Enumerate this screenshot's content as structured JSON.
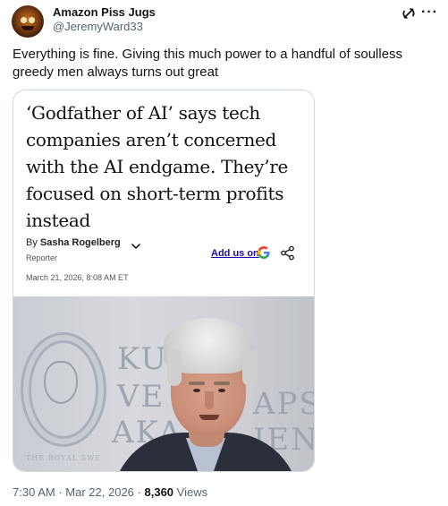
{
  "author": {
    "display_name": "Amazon Piss Jugs",
    "handle": "@JeremyWard33"
  },
  "tweet": {
    "text": "Everything is fine.  Giving this much power to a handful of soulless greedy men always turns out great"
  },
  "article": {
    "headline": "‘Godfather of AI’ says tech companies aren’t concerned with the AI endgame. They’re focused on short-term profits instead",
    "byline_prefix": "By",
    "author": "Sasha Rogelberg",
    "role": "Reporter",
    "date": "March 21, 2026, 8:08 AM ET",
    "add_us_label": "Add us on",
    "photo_wall_text": {
      "line1": "KU",
      "line2": "VE",
      "line3": "AKA",
      "right1": "APS",
      "right2": "IEN",
      "small": "THE ROYAL SWE"
    }
  },
  "meta": {
    "time": "7:30 AM",
    "separator": "·",
    "date": "Mar 22, 2026",
    "views_count": "8,360",
    "views_label": "Views"
  },
  "icons": {
    "grok": "grok-icon",
    "more": "more-icon",
    "chevron": "chevron-down-icon",
    "google": "google-icon",
    "share": "share-icon"
  },
  "colors": {
    "text_primary": "#0f1419",
    "text_secondary": "#536471",
    "card_border": "#cfd9de",
    "link": "#1a0dab"
  }
}
